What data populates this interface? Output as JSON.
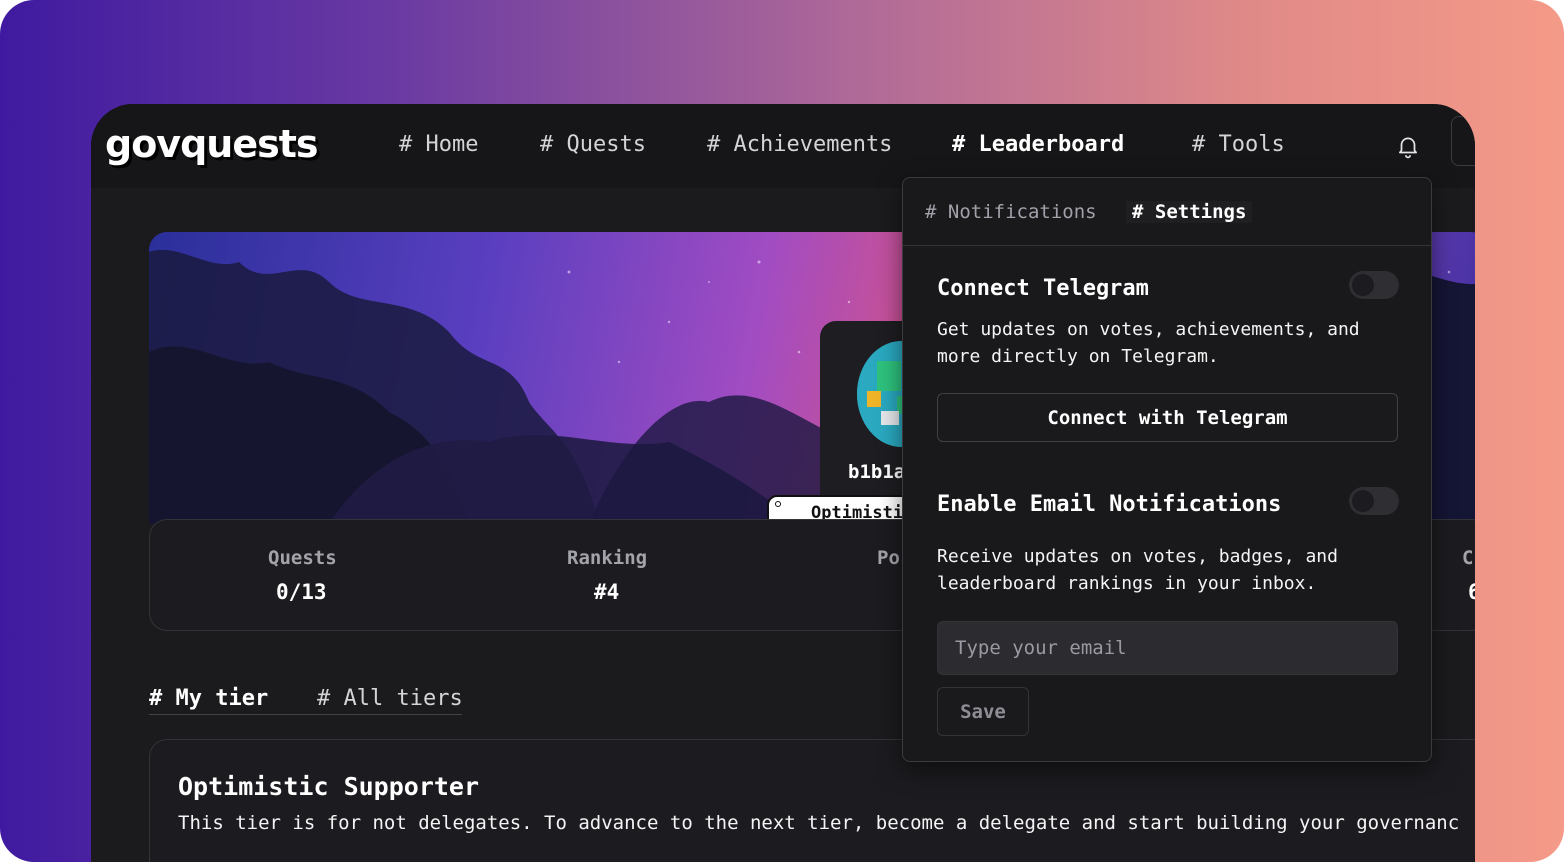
{
  "app": {
    "logo": "govquests"
  },
  "nav": {
    "home": "# Home",
    "quests": "# Quests",
    "achievements": "# Achievements",
    "leaderboard": "# Leaderboard",
    "tools": "# Tools"
  },
  "profile": {
    "username": "b1b1a",
    "tier_badge": "Optimisti"
  },
  "stats": [
    {
      "label": "Quests",
      "value": "0/13"
    },
    {
      "label": "Ranking",
      "value": "#4"
    },
    {
      "label": "Po",
      "value": ""
    },
    {
      "label": "C",
      "value": "6"
    }
  ],
  "tabs": {
    "my_tier": "# My tier",
    "all_tiers": "# All tiers"
  },
  "tier": {
    "title": "Optimistic Supporter",
    "description": "This tier is for not delegates. To advance to the next tier, become a delegate and start building your governanc"
  },
  "dropdown": {
    "tab_notifications": "# Notifications",
    "tab_settings": "# Settings",
    "telegram": {
      "title": "Connect Telegram",
      "description": "Get updates on votes, achievements, and more directly on Telegram.",
      "button": "Connect with Telegram",
      "enabled": false
    },
    "email": {
      "title": "Enable Email Notifications",
      "description": "Receive updates on votes, badges, and leaderboard rankings in your inbox.",
      "placeholder": "Type your email",
      "save": "Save",
      "enabled": false
    }
  },
  "colors": {
    "background_gradient_start": "#3f1aa0",
    "background_gradient_end": "#f59a88",
    "panel": "#19191b",
    "text": "#ffffff"
  }
}
